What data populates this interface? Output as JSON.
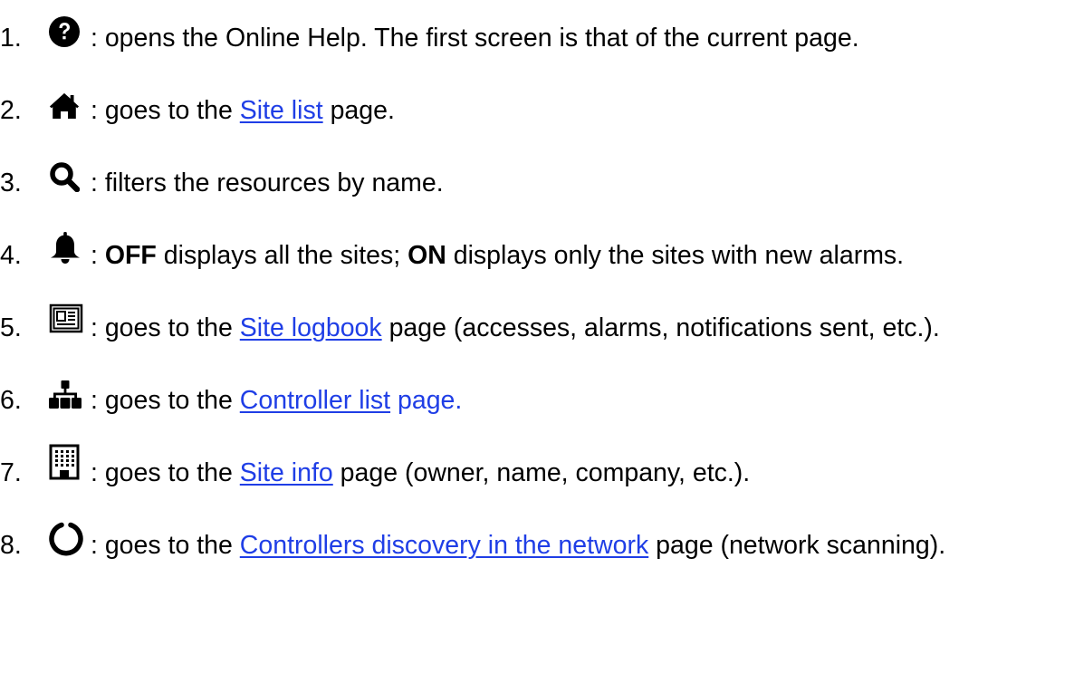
{
  "items": [
    {
      "number": "1.",
      "icon": "question-circle-icon",
      "pre": ": opens the Online Help. The first screen is that of the current page."
    },
    {
      "number": "2.",
      "icon": "home-icon",
      "pre": ": goes to the ",
      "link": "Site list",
      "post": " page."
    },
    {
      "number": "3.",
      "icon": "search-icon",
      "pre": ": filters the resources by name."
    },
    {
      "number": "4.",
      "icon": "bell-icon",
      "pre": ": ",
      "bold1": "OFF",
      "mid": " displays all the sites; ",
      "bold2": "ON",
      "post": " displays only the sites with new alarms."
    },
    {
      "number": "5.",
      "icon": "newspaper-icon",
      "pre": ": goes to the ",
      "link": "Site logbook",
      "post": " page (accesses, alarms, notifications sent, etc.)."
    },
    {
      "number": "6.",
      "icon": "sitemap-icon",
      "pre": ": goes to the ",
      "link": "Controller list",
      "post_link": " page."
    },
    {
      "number": "7.",
      "icon": "building-icon",
      "pre": ": goes to the ",
      "link": "Site info",
      "post": " page (owner, name, company, etc.)."
    },
    {
      "number": "8.",
      "icon": "circle-notch-icon",
      "pre": ": goes to the ",
      "link": "Controllers discovery in the network",
      "post": " page (network scanning)."
    }
  ],
  "colors": {
    "text": "#000000",
    "link": "#1f3ee6"
  }
}
